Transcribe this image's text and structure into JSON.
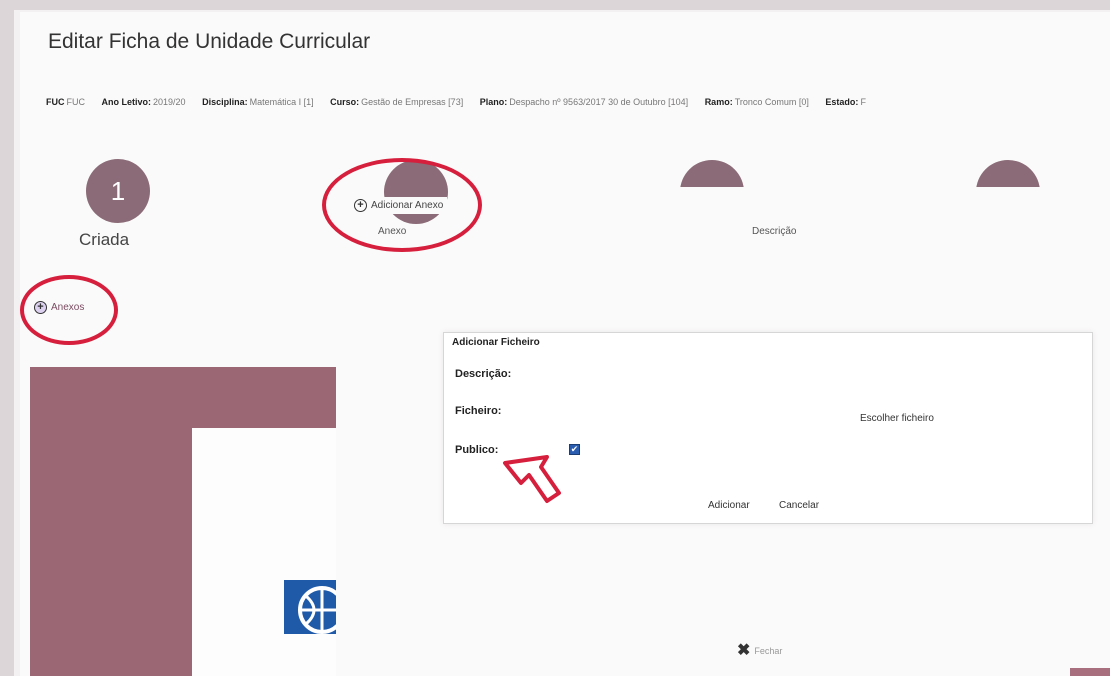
{
  "page": {
    "title": "Editar Ficha de Unidade Curricular"
  },
  "meta": [
    {
      "key": "FUC",
      "value": "FUC"
    },
    {
      "key": "Ano Letivo:",
      "value": "2019/20"
    },
    {
      "key": "Disciplina:",
      "value": "Matemática I [1]"
    },
    {
      "key": "Curso:",
      "value": "Gestão de Empresas [73]"
    },
    {
      "key": "Plano:",
      "value": "Despacho nº 9563/2017 30 de Outubro [104]"
    },
    {
      "key": "Ramo:",
      "value": "Tronco Comum [0]"
    },
    {
      "key": "Estado:",
      "value": "F"
    }
  ],
  "steps": {
    "step1": {
      "number": "1",
      "label": "Criada"
    },
    "step2": {
      "label": "Anexo",
      "add_label": "Adicionar Anexo"
    },
    "step3": {
      "label": "Descrição"
    }
  },
  "anexos_button": {
    "label": "Anexos"
  },
  "modal": {
    "title": "Adicionar Ficheiro",
    "descricao_label": "Descrição:",
    "ficheiro_label": "Ficheiro:",
    "choose_file": "Escolher ficheiro",
    "publico_label": "Publico:",
    "publico_checked": true,
    "add_button": "Adicionar",
    "cancel_button": "Cancelar"
  },
  "footer": {
    "close_label": "Fechar"
  },
  "colors": {
    "accent": "#8a6b77",
    "highlight_ring": "#d61f3c",
    "panel": "#9b6774"
  }
}
